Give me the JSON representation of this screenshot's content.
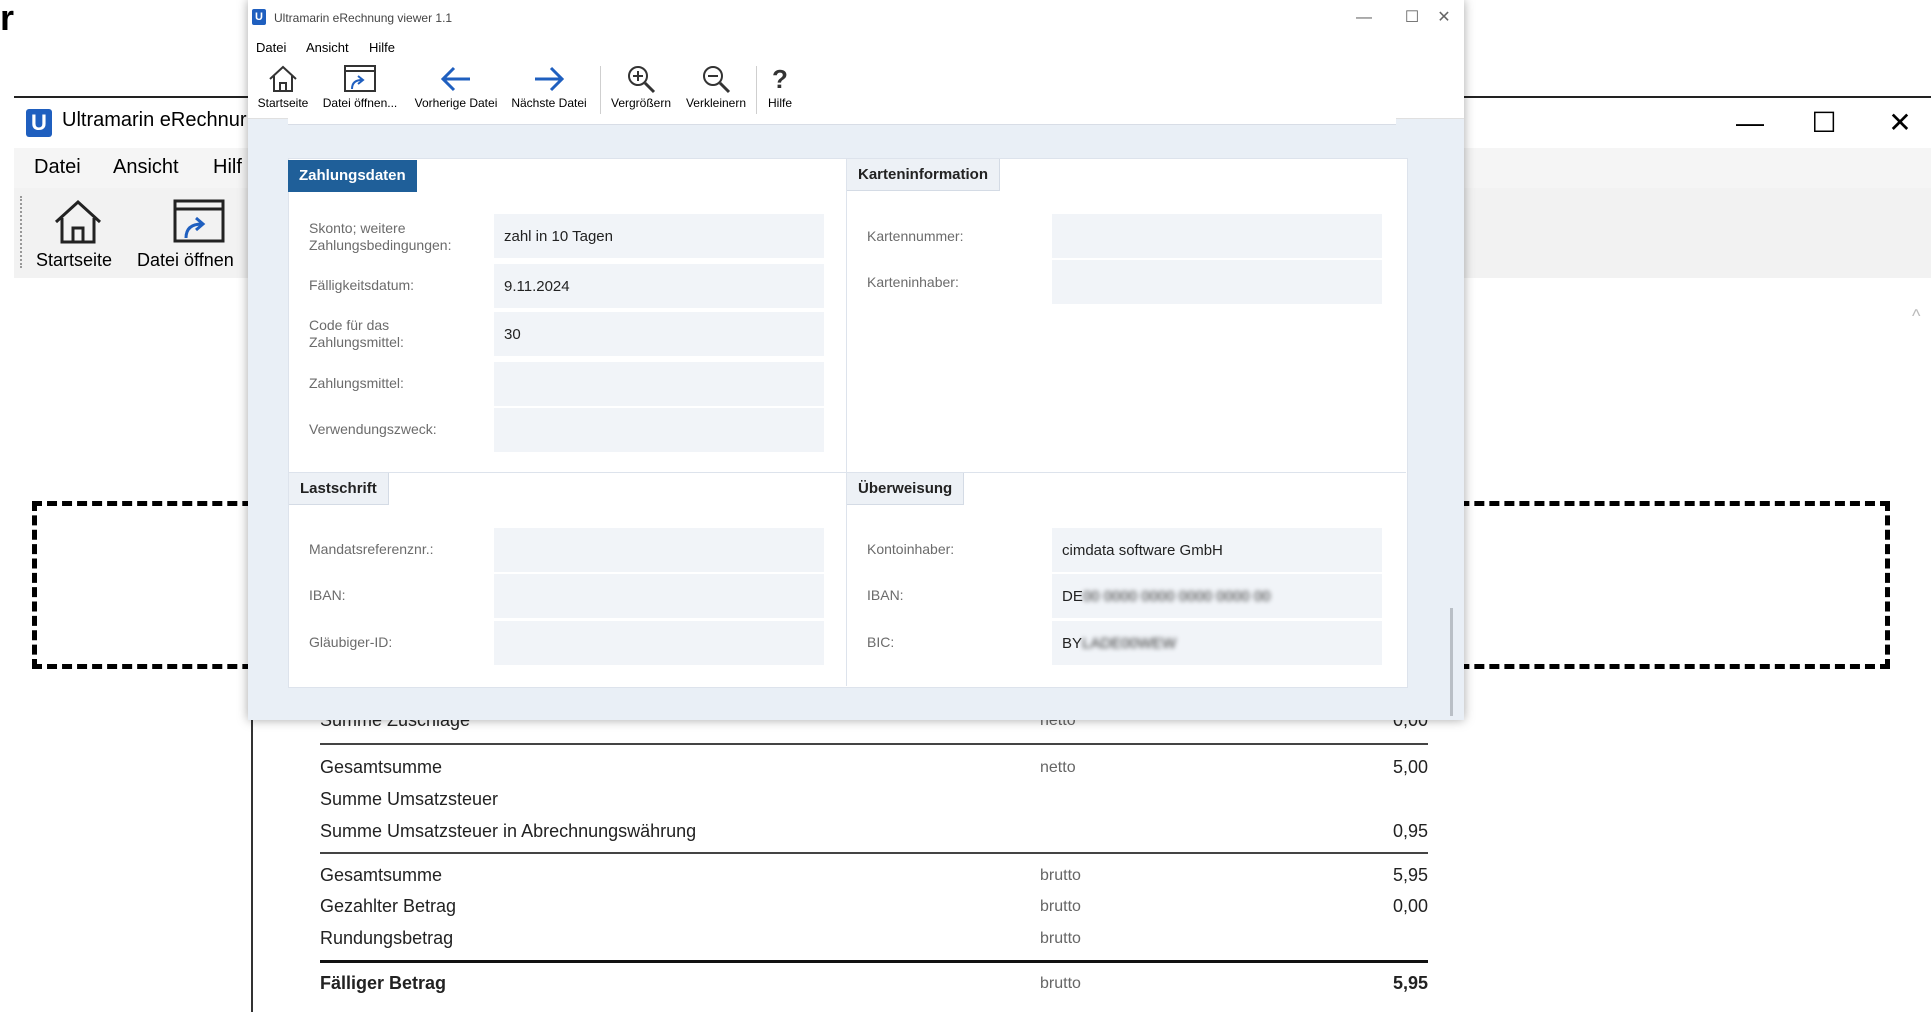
{
  "background_window": {
    "partial_letter": "r",
    "title": "Ultramarin eRechnur",
    "logo": "U",
    "menu": [
      "Datei",
      "Ansicht",
      "Hilf"
    ],
    "tools": [
      {
        "label": "Startseite",
        "icon": "home-icon"
      },
      {
        "label": "Datei öffnen",
        "icon": "open-file-icon"
      }
    ],
    "controls": {
      "minimize": "—",
      "maximize": "☐",
      "close": "✕"
    },
    "scroll_up": "^"
  },
  "viewer": {
    "title": "Ultramarin eRechnung viewer 1.1",
    "logo": "U",
    "controls": {
      "minimize": "—",
      "maximize": "☐",
      "close": "✕"
    },
    "menu": [
      "Datei",
      "Ansicht",
      "Hilfe"
    ],
    "toolbar": [
      {
        "label": "Startseite",
        "icon": "home-icon"
      },
      {
        "label": "Datei öffnen...",
        "icon": "open-file-icon"
      },
      {
        "label": "Vorherige Datei",
        "icon": "arrow-left-icon"
      },
      {
        "label": "Nächste Datei",
        "icon": "arrow-right-icon"
      },
      {
        "label": "Vergrößern",
        "icon": "zoom-in-icon"
      },
      {
        "label": "Verkleinern",
        "icon": "zoom-out-icon"
      },
      {
        "label": "Hilfe",
        "icon": "help-icon"
      }
    ]
  },
  "zahlungsdaten": {
    "header": "Zahlungsdaten",
    "fields": [
      {
        "label": "Skonto; weitere Zahlungsbedingungen:",
        "value": "zahl in 10 Tagen"
      },
      {
        "label": "Fälligkeitsdatum:",
        "value": "9.11.2024"
      },
      {
        "label": "Code für das Zahlungsmittel:",
        "value": "30"
      },
      {
        "label": "Zahlungsmittel:",
        "value": ""
      },
      {
        "label": "Verwendungszweck:",
        "value": ""
      }
    ]
  },
  "karteninformation": {
    "header": "Karteninformation",
    "fields": [
      {
        "label": "Kartennummer:",
        "value": ""
      },
      {
        "label": "Karteninhaber:",
        "value": ""
      }
    ]
  },
  "lastschrift": {
    "header": "Lastschrift",
    "fields": [
      {
        "label": "Mandatsreferenznr.:",
        "value": ""
      },
      {
        "label": "IBAN:",
        "value": ""
      },
      {
        "label": "Gläubiger-ID:",
        "value": ""
      }
    ]
  },
  "ueberweisung": {
    "header": "Überweisung",
    "fields": [
      {
        "label": "Kontoinhaber:",
        "value": "cimdata software GmbH"
      },
      {
        "label": "IBAN:",
        "value": "DE",
        "blurred": "00 0000 0000 0000 0000 00"
      },
      {
        "label": "BIC:",
        "value": "BY",
        "blurred": "LADE00WEW"
      }
    ]
  },
  "summary": [
    {
      "label": "Summe Zuschläge",
      "qualifier": "netto",
      "value": "0,00"
    },
    {
      "label": "Gesamtsumme",
      "qualifier": "netto",
      "value": "5,00"
    },
    {
      "label": "Summe Umsatzsteuer",
      "qualifier": "",
      "value": ""
    },
    {
      "label": "Summe Umsatzsteuer in Abrechnungswährung",
      "qualifier": "",
      "value": "0,95"
    },
    {
      "label": "Gesamtsumme",
      "qualifier": "brutto",
      "value": "5,95"
    },
    {
      "label": "Gezahlter Betrag",
      "qualifier": "brutto",
      "value": "0,00"
    },
    {
      "label": "Rundungsbetrag",
      "qualifier": "brutto",
      "value": ""
    },
    {
      "label": "Fälliger Betrag",
      "qualifier": "brutto",
      "value": "5,95"
    }
  ],
  "colors": {
    "active_header": "#1f5f99",
    "logo_blue": "#1f5fbf",
    "icon_blue": "#1f5fbf",
    "field_background": "#f1f4f8"
  }
}
